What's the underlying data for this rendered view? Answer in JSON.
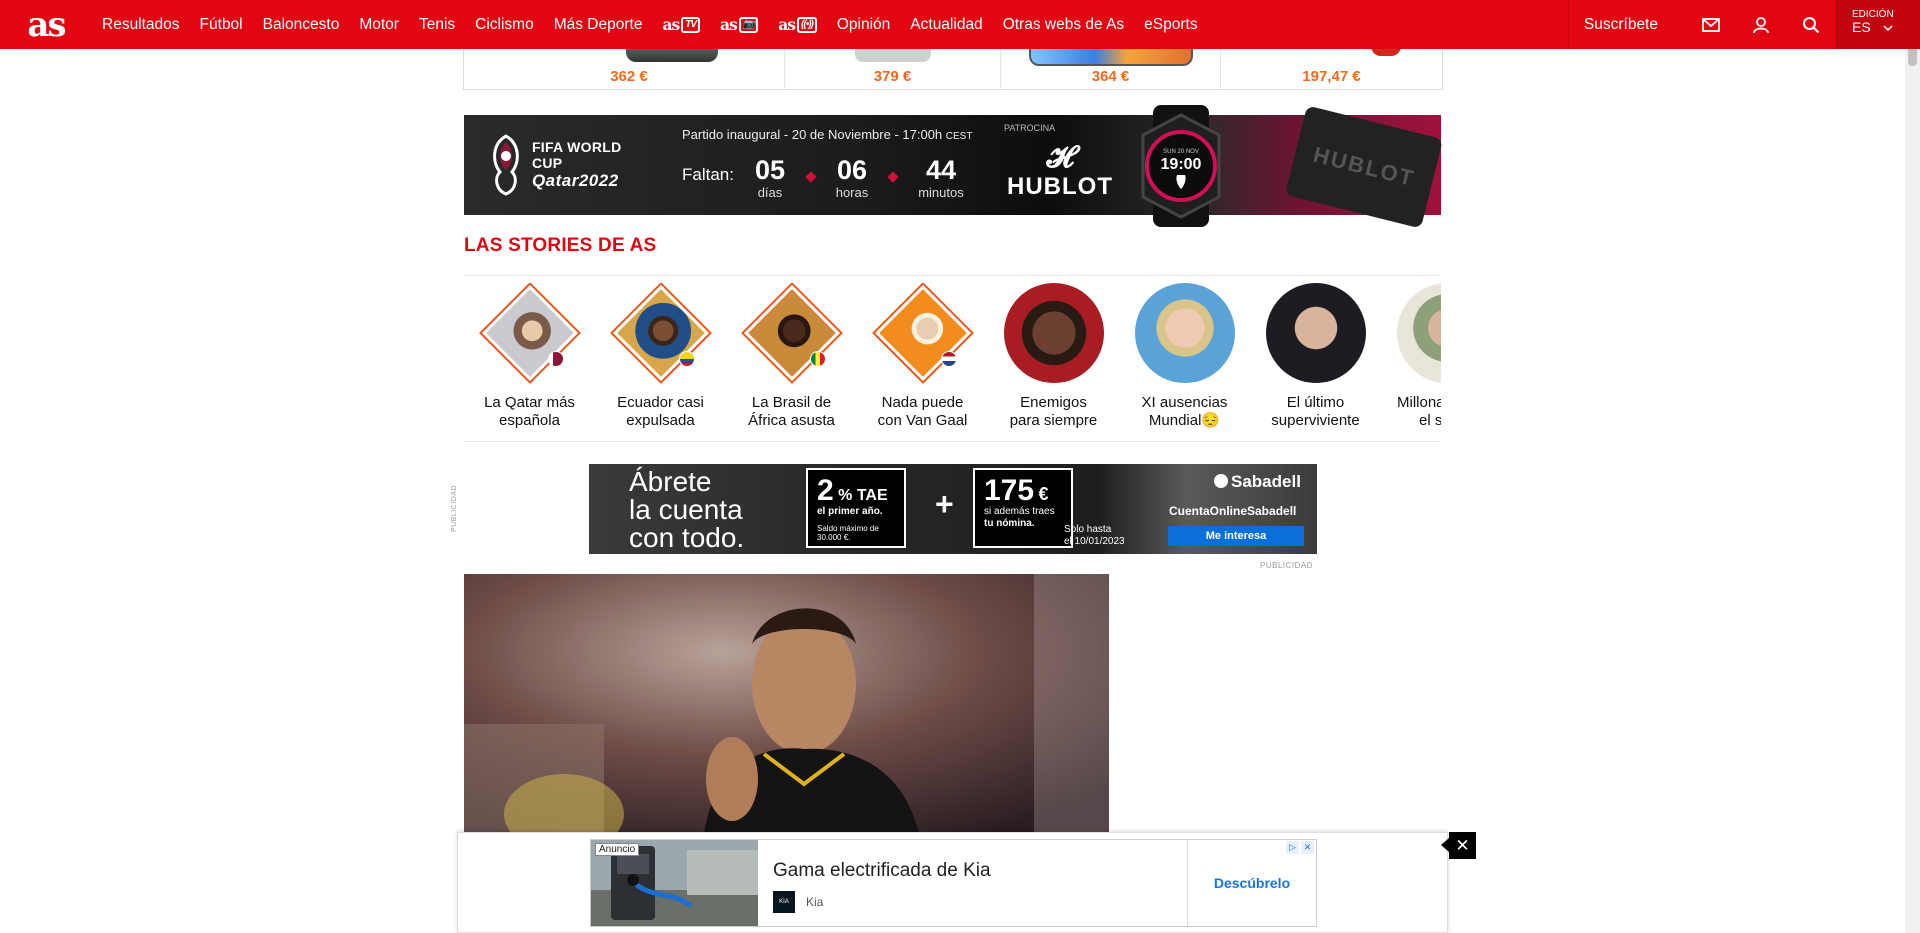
{
  "nav": {
    "logo": "as",
    "items": [
      "Resultados",
      "Fútbol",
      "Baloncesto",
      "Motor",
      "Tenis",
      "Ciclismo",
      "Más Deporte"
    ],
    "brands": [
      {
        "name": "as",
        "tag": "TV"
      },
      {
        "name": "as",
        "tag": "📷"
      },
      {
        "name": "as",
        "tag": "((•))"
      }
    ],
    "items2": [
      "Opinión",
      "Actualidad",
      "Otras webs de As",
      "eSports"
    ],
    "subscribe": "Suscríbete",
    "edition_label": "EDICIÓN",
    "edition_value": "ES",
    "icons": [
      "mail-icon",
      "user-icon",
      "search-icon"
    ]
  },
  "products": {
    "prices": [
      "362 €",
      "379 €",
      "364 €",
      "197,47 €"
    ]
  },
  "worldcup": {
    "logo_line1": "FIFA WORLD CUP",
    "logo_line2": "Qatar2022",
    "match": "Partido inaugural - 20 de Noviembre - 17:00h",
    "match_tz": "CEST",
    "faltan": "Faltan:",
    "days": "05",
    "days_label": "días",
    "hours": "06",
    "hours_label": "horas",
    "minutes": "44",
    "minutes_label": "minutos",
    "sponsor_label": "PATROCINA",
    "sponsor": "HUBLOT",
    "watch_date": "SUN 20 NOV",
    "watch_time": "19:00",
    "strap_text": "HUBLOT"
  },
  "stories": {
    "title": "LAS STORIES DE AS",
    "items": [
      {
        "l1": "La Qatar más",
        "l2": "española",
        "shape": "diamond"
      },
      {
        "l1": "Ecuador casi",
        "l2": "expulsada",
        "shape": "diamond"
      },
      {
        "l1": "La Brasil de",
        "l2": "África asusta",
        "shape": "diamond"
      },
      {
        "l1": "Nada puede",
        "l2": "con Van Gaal",
        "shape": "diamond"
      },
      {
        "l1": "Enemigos",
        "l2": "para siempre",
        "shape": "circle"
      },
      {
        "l1": "XI ausencias",
        "l2": "Mundial😔",
        "shape": "circle"
      },
      {
        "l1": "El último",
        "l2": "superviviente",
        "shape": "circle"
      },
      {
        "l1": "Millonar",
        "l2": "el ska",
        "shape": "circle"
      }
    ]
  },
  "sabadell": {
    "pub_vertical": "PUBLICIDAD",
    "line1": "Ábrete",
    "line2a": "la ",
    "line2b": "cuenta",
    "line3": "con todo.",
    "box1_big": "2",
    "box1_unit": "% TAE",
    "box1_sub": "el primer año.",
    "box1_small": "Saldo máximo de 30.000 €.",
    "plus": "+",
    "box2_big": "175",
    "box2_unit": "€",
    "box2_sub1": "si además traes",
    "box2_sub2": "tu nómina.",
    "solo": "Solo hasta",
    "date": "el 10/01/2023",
    "logo": "Sabadell",
    "cta_text": "CuentaOnlineSabadell",
    "button": "Me interesa",
    "pub_horizontal": "PUBLICIDAD"
  },
  "bottom_ad": {
    "badge": "Anuncio",
    "title": "Gama electrificada de Kia",
    "brand": "Kia",
    "brand_logo": "KIA",
    "cta": "Descúbrelo",
    "close": "✕"
  }
}
